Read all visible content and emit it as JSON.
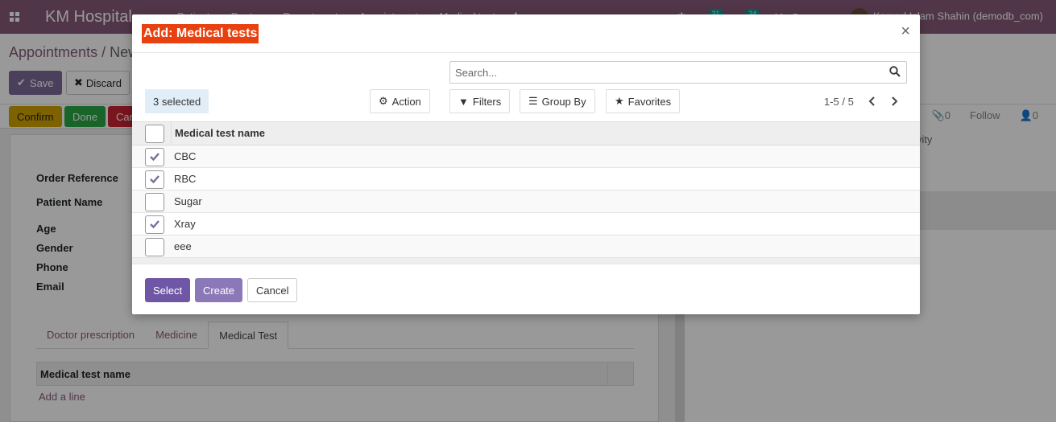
{
  "app": {
    "brand": "KM Hospital",
    "menu": [
      "Patients",
      "Doctors",
      "Departments",
      "Appointments",
      "Medical test"
    ],
    "badges": {
      "activity": "21",
      "messages": "24"
    },
    "company": "My Company",
    "user": "Kamrul Islam Shahin (demodb_com)"
  },
  "breadcrumb": {
    "parent": "Appointments",
    "separator": " / ",
    "current": "New"
  },
  "form_actions": {
    "save": "Save",
    "discard": "Discard"
  },
  "status_buttons": {
    "confirm": "Confirm",
    "done": "Done",
    "cancel": "Can"
  },
  "chatter": {
    "attachments": "0",
    "follow": "Follow",
    "followers": "0",
    "activity": "ivity"
  },
  "form_fields": [
    "Order Reference",
    "Patient Name",
    "Age",
    "Gender",
    "Phone",
    "Email"
  ],
  "form_tabs": [
    "Doctor prescription",
    "Medicine",
    "Medical Test"
  ],
  "subtable": {
    "header": "Medical test name",
    "add_line": "Add a line"
  },
  "modal": {
    "title": "Add: Medical tests",
    "close": "×",
    "search_placeholder": "Search...",
    "selected_count": "3 selected",
    "toolbar": {
      "action": "Action",
      "filters": "Filters",
      "group_by": "Group By",
      "favorites": "Favorites"
    },
    "pager": "1-5 / 5",
    "column_header": "Medical test name",
    "rows": [
      {
        "name": "CBC",
        "checked": true
      },
      {
        "name": "RBC",
        "checked": true
      },
      {
        "name": "Sugar",
        "checked": false
      },
      {
        "name": "Xray",
        "checked": true
      },
      {
        "name": "eee",
        "checked": false
      }
    ],
    "footer": {
      "select": "Select",
      "create": "Create",
      "cancel": "Cancel"
    }
  },
  "colors": {
    "title_bg": "#e8400e",
    "primary": "#6f57a6",
    "brand": "#875a7b",
    "selected_bg": "#e2eef7"
  }
}
